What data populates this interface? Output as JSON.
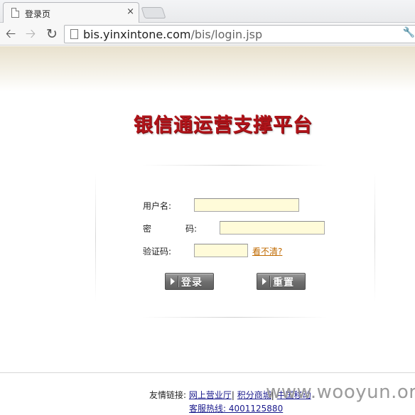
{
  "browser": {
    "tab_title": "登录页",
    "tab_close": "×",
    "url_host": "bis.yinxintone.com",
    "url_path": "/bis/login.jsp",
    "back_icon": "arrow-left-icon",
    "forward_icon": "arrow-right-icon",
    "reload_icon": "reload-icon"
  },
  "page": {
    "site_title": "银信通运营支撑平台"
  },
  "form": {
    "username_label": "用户名:",
    "password_label_1": "密",
    "password_label_2": "码:",
    "captcha_label": "验证码:",
    "username_value": "",
    "password_value": "",
    "captcha_value": "",
    "captcha_refresh_link": "看不清?",
    "login_button": "登录",
    "reset_button": "重置"
  },
  "footer": {
    "links_label": "友情链接:",
    "link_1": "网上营业厅",
    "link_2": "积分商城",
    "link_3": "中国移动",
    "hotline": "客服热线: 4001125880"
  },
  "watermark": "www.wooyun.org",
  "colors": {
    "title_red": "#b0141a",
    "input_bg": "#fffbd9",
    "link_orange": "#c06a00",
    "link_blue": "#1a1a8c"
  }
}
